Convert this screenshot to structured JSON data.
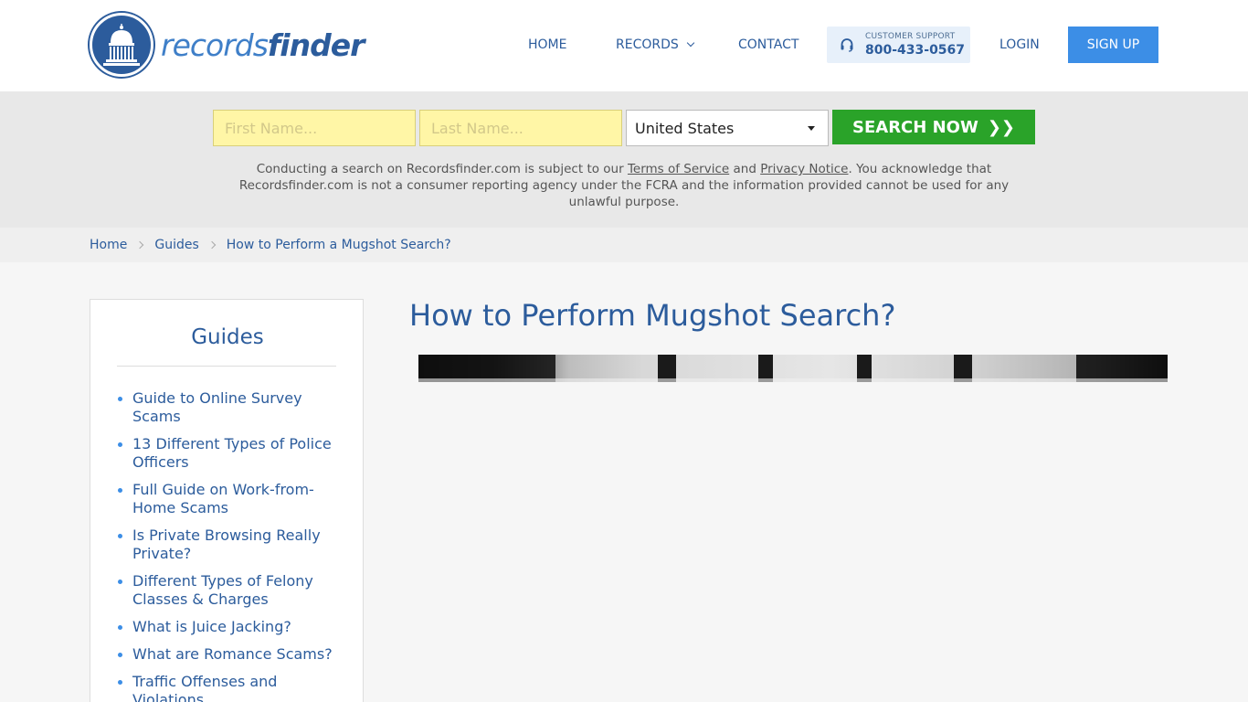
{
  "header": {
    "logo": {
      "text_a": "records",
      "text_b": "finder"
    },
    "nav": {
      "home": "HOME",
      "records": "RECORDS",
      "contact": "CONTACT",
      "login": "LOGIN"
    },
    "support": {
      "label": "CUSTOMER SUPPORT",
      "phone": "800-433-0567"
    },
    "signup": "SIGN UP"
  },
  "search": {
    "first_placeholder": "First Name...",
    "last_placeholder": "Last Name...",
    "country": "United States",
    "button": "SEARCH NOW",
    "disclaimer": {
      "part1": "Conducting a search on Recordsfinder.com is subject to our ",
      "terms": "Terms of Service",
      "and": " and ",
      "privacy": "Privacy Notice",
      "part2": ". You acknowledge that Recordsfinder.com is not a consumer reporting agency under the FCRA and the information provided cannot be used for any unlawful purpose."
    }
  },
  "breadcrumb": [
    "Home",
    "Guides",
    "How to Perform a Mugshot Search?"
  ],
  "sidebar": {
    "title": "Guides",
    "items": [
      "Guide to Online Survey Scams",
      "13 Different Types of Police Officers",
      "Full Guide on Work-from-Home Scams",
      "Is Private Browsing Really Private?",
      "Different Types of Felony Classes & Charges",
      "What is Juice Jacking?",
      "What are Romance Scams?",
      "Traffic Offenses and Violations"
    ]
  },
  "main": {
    "title": "How to Perform Mugshot Search?"
  },
  "colors": {
    "brand": "#2c5c9c",
    "signup": "#3c8ee6",
    "search_button": "#2aa329",
    "input_bg": "#fff6a6"
  }
}
